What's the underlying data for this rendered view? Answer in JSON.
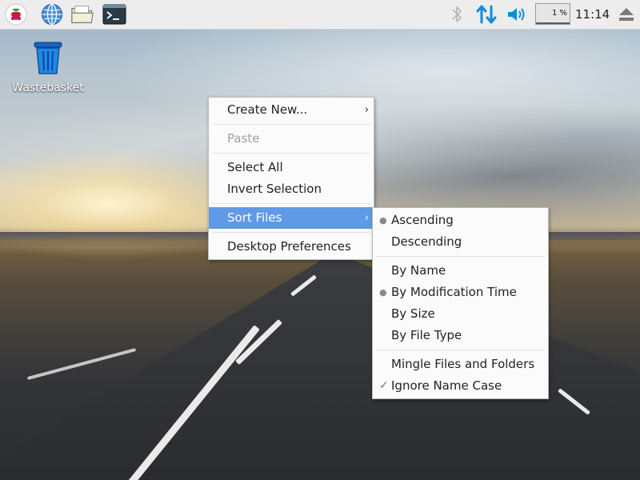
{
  "taskbar": {
    "launchers": [
      "raspberry-menu-icon",
      "web-browser-icon",
      "file-manager-icon",
      "terminal-icon"
    ],
    "tray": [
      "bluetooth-icon",
      "network-transfer-icon",
      "volume-icon"
    ],
    "cpu_usage": "1 %",
    "clock": "11:14",
    "eject_icon": "eject-icon",
    "accent_color": "#0a8ce0"
  },
  "desktop": {
    "wastebasket_label": "Wastebasket"
  },
  "context_menu": {
    "items": [
      {
        "label": "Create New...",
        "submenu": true,
        "disabled": false
      },
      {
        "label": "Paste",
        "disabled": true
      },
      {
        "label": "Select All",
        "disabled": false
      },
      {
        "label": "Invert Selection",
        "disabled": false
      },
      {
        "label": "Sort Files",
        "submenu": true,
        "active": true
      },
      {
        "label": "Desktop Preferences",
        "disabled": false
      }
    ],
    "highlight_color": "#5e9ae6"
  },
  "sort_submenu": {
    "items": [
      {
        "label": "Ascending",
        "selected": true
      },
      {
        "label": "Descending",
        "selected": false
      },
      {
        "label": "By Name",
        "selected": false
      },
      {
        "label": "By Modification Time",
        "selected": true
      },
      {
        "label": "By Size",
        "selected": false
      },
      {
        "label": "By File Type",
        "selected": false
      },
      {
        "label": "Mingle Files and Folders",
        "checked": false
      },
      {
        "label": "Ignore Name Case",
        "checked": true
      }
    ]
  }
}
